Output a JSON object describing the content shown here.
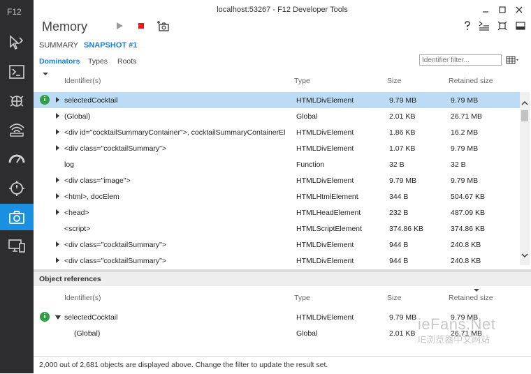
{
  "window": {
    "title": "localhost:53267 - F12 Developer Tools"
  },
  "sidebar": {
    "brand": "F12",
    "items": [
      {
        "icon": "dom-explorer-icon"
      },
      {
        "icon": "console-icon"
      },
      {
        "icon": "debugger-icon"
      },
      {
        "icon": "network-icon"
      },
      {
        "icon": "ui-responsiveness-icon"
      },
      {
        "icon": "profiler-icon"
      },
      {
        "icon": "memory-icon",
        "active": true
      },
      {
        "icon": "emulation-icon"
      }
    ],
    "accent_color": "#1b8fe0"
  },
  "toolbar": {
    "tool_name": "Memory"
  },
  "tabs": {
    "summary": "SUMMARY",
    "snapshot": "SNAPSHOT #1"
  },
  "subtabs": {
    "dominators": "Dominators",
    "types": "Types",
    "roots": "Roots"
  },
  "filter": {
    "placeholder": "Identifier filter..."
  },
  "columns": {
    "identifier": "Identifier(s)",
    "type": "Type",
    "size": "Size",
    "retained_size": "Retained size"
  },
  "rows": [
    {
      "identifier": "selectedCocktail",
      "type": "HTMLDivElement",
      "size": "9.79 MB",
      "retained": "9.79 MB",
      "expandable": true,
      "selected": true,
      "info": true
    },
    {
      "identifier": "(Global)",
      "type": "Global",
      "size": "2.01 KB",
      "retained": "26.71 MB",
      "expandable": true
    },
    {
      "identifier": "<div id=\"cocktailSummaryContainer\">, cocktailSummaryContainerEl",
      "type": "HTMLDivElement",
      "size": "1.86 KB",
      "retained": "16.2 MB",
      "expandable": true
    },
    {
      "identifier": "<div class=\"cocktailSummary\">",
      "type": "HTMLDivElement",
      "size": "1.07 KB",
      "retained": "9.79 MB",
      "expandable": true
    },
    {
      "identifier": "log",
      "type": "Function",
      "size": "32 B",
      "retained": "32 B",
      "expandable": false
    },
    {
      "identifier": "<div class=\"image\">",
      "type": "HTMLDivElement",
      "size": "9.79 MB",
      "retained": "9.79 MB",
      "expandable": true
    },
    {
      "identifier": "<html>, docElem",
      "type": "HTMLHtmlElement",
      "size": "344 B",
      "retained": "504.67 KB",
      "expandable": true
    },
    {
      "identifier": "<head>",
      "type": "HTMLHeadElement",
      "size": "232 B",
      "retained": "487.09 KB",
      "expandable": true
    },
    {
      "identifier": "<script>",
      "type": "HTMLScriptElement",
      "size": "374.86 KB",
      "retained": "374.86 KB",
      "expandable": false
    },
    {
      "identifier": "<div class=\"cocktailSummary\">",
      "type": "HTMLDivElement",
      "size": "944 B",
      "retained": "240.8 KB",
      "expandable": true
    },
    {
      "identifier": "<div class=\"cocktailSummary\">",
      "type": "HTMLDivElement",
      "size": "944 B",
      "retained": "240.8 KB",
      "expandable": true
    }
  ],
  "object_references": {
    "title": "Object references",
    "rows": [
      {
        "identifier": "selectedCocktail",
        "type": "HTMLDivElement",
        "size": "9.79 MB",
        "retained": "9.79 MB",
        "expanded": true,
        "info": true
      },
      {
        "identifier": "(Global)",
        "type": "Global",
        "size": "2.01 KB",
        "retained": "26.71 MB",
        "child": true
      }
    ]
  },
  "status": {
    "text": "2,000 out of 2,681 objects are displayed above. Change the filter to update the result set."
  },
  "watermark": {
    "line1": "ieFans.Net",
    "line2": "IE浏览器中文网站"
  }
}
